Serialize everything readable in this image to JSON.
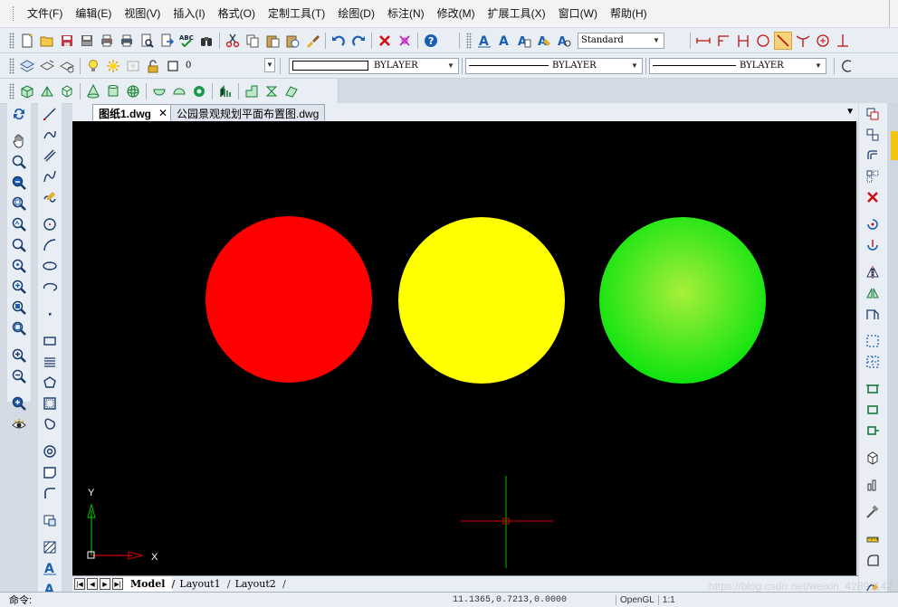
{
  "menu": [
    "文件(F)",
    "编辑(E)",
    "视图(V)",
    "插入(I)",
    "格式(O)",
    "定制工具(T)",
    "绘图(D)",
    "标注(N)",
    "修改(M)",
    "扩展工具(X)",
    "窗口(W)",
    "帮助(H)"
  ],
  "toolbar": {
    "text_style": "Standard",
    "layer": "0",
    "color": "BYLAYER",
    "linetype": "BYLAYER",
    "lineweight": "BYLAYER"
  },
  "tabs": [
    {
      "label": "图纸1.dwg",
      "close": "✕"
    },
    {
      "label": "公园景观规划平面布置图.dwg"
    }
  ],
  "layout_tabs": [
    "Model",
    "Layout1",
    "Layout2"
  ],
  "nav_buttons": [
    "|◀",
    "◀",
    "▶",
    "▶|"
  ],
  "ucs": {
    "x": "X",
    "y": "Y"
  },
  "circles": [
    {
      "name": "red",
      "color": "#ff0000"
    },
    {
      "name": "yellow",
      "color": "#ffff00"
    },
    {
      "name": "green",
      "color": "#0fe40f",
      "highlight": "#a8ef3a"
    }
  ],
  "crosshair_colors": {
    "horizontal": "#d40000",
    "vertical": "#00c000"
  },
  "status": {
    "command_label": "命令:",
    "coords": "11.1365,0.7213,0.0000",
    "renderer": "OpenGL",
    "scale": "1:1"
  },
  "watermark": "https://blog.csdn.net/weixin_42891142"
}
